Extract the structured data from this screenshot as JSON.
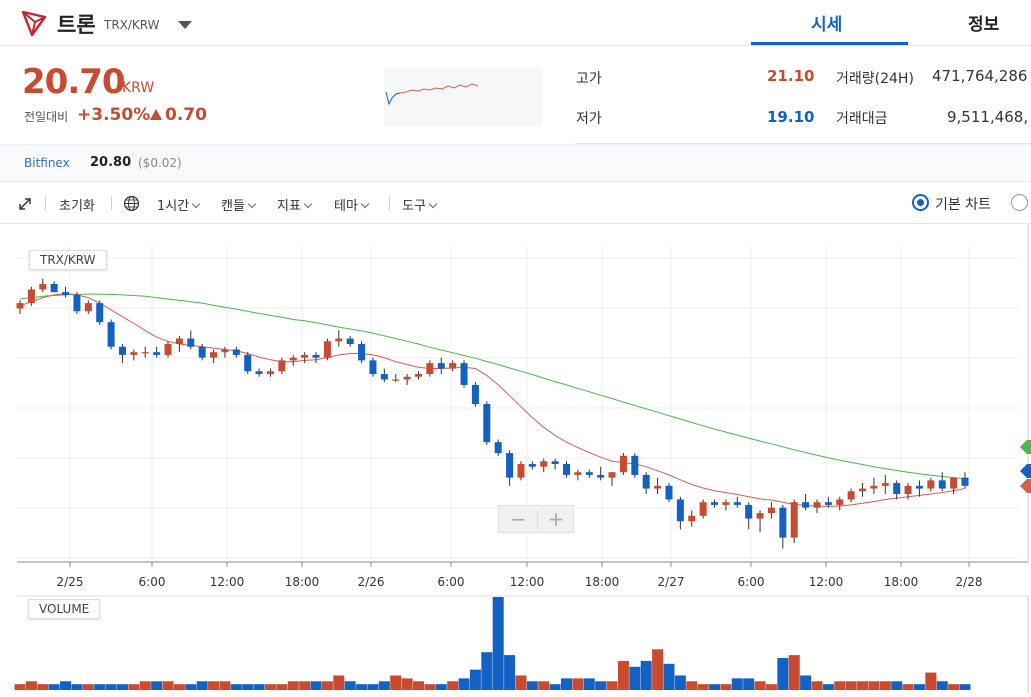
{
  "header": {
    "coin_name": "트론",
    "pair": "TRX/KRW",
    "tabs": [
      {
        "label": "시세"
      },
      {
        "label": "정보"
      }
    ]
  },
  "ticker": {
    "price": "20.70",
    "unit": "KRW",
    "change_label": "전일대비",
    "change_rate": "+3.50%",
    "change_amount": "0.70",
    "high_label": "고가",
    "high": "21.10",
    "low_label": "저가",
    "low": "19.10",
    "volume_label": "거래량(24H)",
    "volume": "471,764,286",
    "amount_label": "거래대금",
    "amount": "9,511,468,"
  },
  "exchange": {
    "name": "Bitfinex",
    "price": "20.80",
    "diff": "($0.02)"
  },
  "toolbar": {
    "reset": "초기화",
    "interval": "1시간",
    "candle": "캔들",
    "indicator": "지표",
    "theme": "테마",
    "tools": "도구",
    "basic_chart": "기본 차트"
  },
  "colors": {
    "up": "#c84a31",
    "down": "#1261c4",
    "accent": "#1261c4",
    "ma_short": "#d4604e",
    "ma_long": "#4ab84a"
  },
  "chart_data": {
    "type": "candlestick",
    "title": "TRX/KRW",
    "volume_title": "VOLUME",
    "x_tick_labels": [
      "2/25",
      "6:00",
      "12:00",
      "18:00",
      "2/26",
      "6:00",
      "12:00",
      "18:00",
      "2/27",
      "6:00",
      "12:00",
      "18:00",
      "2/28"
    ],
    "candles_ohlc": [
      [
        23.0,
        23.3,
        22.8,
        23.2
      ],
      [
        23.2,
        23.8,
        23.1,
        23.7
      ],
      [
        23.7,
        24.1,
        23.6,
        23.9
      ],
      [
        23.9,
        24.0,
        23.6,
        23.6
      ],
      [
        23.6,
        23.8,
        23.4,
        23.5
      ],
      [
        23.5,
        23.6,
        22.8,
        22.9
      ],
      [
        22.9,
        23.3,
        22.8,
        23.2
      ],
      [
        23.2,
        23.3,
        22.4,
        22.5
      ],
      [
        22.5,
        22.6,
        21.5,
        21.6
      ],
      [
        21.6,
        21.7,
        21.0,
        21.3
      ],
      [
        21.3,
        21.5,
        21.1,
        21.4
      ],
      [
        21.4,
        21.6,
        21.2,
        21.4
      ],
      [
        21.4,
        21.6,
        21.2,
        21.3
      ],
      [
        21.3,
        21.8,
        21.2,
        21.7
      ],
      [
        21.7,
        22.0,
        21.4,
        21.9
      ],
      [
        21.9,
        22.2,
        21.5,
        21.6
      ],
      [
        21.6,
        21.7,
        21.1,
        21.2
      ],
      [
        21.2,
        21.5,
        21.0,
        21.4
      ],
      [
        21.4,
        21.6,
        21.2,
        21.5
      ],
      [
        21.5,
        21.6,
        21.2,
        21.3
      ],
      [
        21.3,
        21.4,
        20.6,
        20.7
      ],
      [
        20.7,
        20.8,
        20.5,
        20.6
      ],
      [
        20.6,
        20.8,
        20.5,
        20.7
      ],
      [
        20.7,
        21.2,
        20.6,
        21.1
      ],
      [
        21.1,
        21.3,
        20.9,
        21.2
      ],
      [
        21.2,
        21.4,
        21.0,
        21.3
      ],
      [
        21.3,
        21.4,
        21.0,
        21.2
      ],
      [
        21.2,
        21.9,
        21.1,
        21.8
      ],
      [
        21.8,
        22.2,
        21.6,
        21.9
      ],
      [
        21.9,
        22.0,
        21.6,
        21.7
      ],
      [
        21.7,
        21.8,
        21.0,
        21.1
      ],
      [
        21.1,
        21.2,
        20.5,
        20.6
      ],
      [
        20.6,
        20.8,
        20.3,
        20.4
      ],
      [
        20.4,
        20.6,
        20.3,
        20.4
      ],
      [
        20.4,
        20.6,
        20.2,
        20.5
      ],
      [
        20.5,
        20.7,
        20.4,
        20.6
      ],
      [
        20.6,
        21.1,
        20.5,
        21.0
      ],
      [
        21.0,
        21.2,
        20.6,
        20.8
      ],
      [
        20.8,
        21.1,
        20.7,
        21.0
      ],
      [
        21.0,
        21.1,
        20.1,
        20.2
      ],
      [
        20.2,
        20.3,
        19.4,
        19.5
      ],
      [
        19.5,
        19.6,
        18.0,
        18.1
      ],
      [
        18.1,
        18.2,
        17.6,
        17.7
      ],
      [
        17.7,
        17.8,
        16.5,
        16.8
      ],
      [
        16.8,
        17.4,
        16.7,
        17.3
      ],
      [
        17.3,
        17.4,
        17.1,
        17.2
      ],
      [
        17.2,
        17.5,
        17.0,
        17.4
      ],
      [
        17.4,
        17.5,
        17.1,
        17.3
      ],
      [
        17.3,
        17.4,
        16.8,
        16.9
      ],
      [
        16.9,
        17.1,
        16.7,
        17.0
      ],
      [
        17.0,
        17.1,
        16.8,
        16.9
      ],
      [
        16.9,
        17.2,
        16.7,
        16.8
      ],
      [
        16.8,
        17.0,
        16.5,
        17.0
      ],
      [
        17.0,
        17.7,
        16.9,
        17.6
      ],
      [
        17.6,
        17.7,
        16.8,
        16.9
      ],
      [
        16.9,
        17.0,
        16.2,
        16.4
      ],
      [
        16.4,
        16.8,
        16.2,
        16.5
      ],
      [
        16.5,
        16.6,
        15.9,
        16.0
      ],
      [
        16.0,
        16.1,
        14.9,
        15.2
      ],
      [
        15.2,
        15.6,
        15.0,
        15.4
      ],
      [
        15.4,
        16.0,
        15.3,
        15.9
      ],
      [
        15.9,
        16.0,
        15.7,
        15.8
      ],
      [
        15.8,
        16.0,
        15.6,
        15.9
      ],
      [
        15.9,
        16.1,
        15.7,
        15.8
      ],
      [
        15.8,
        15.9,
        14.9,
        15.3
      ],
      [
        15.3,
        15.6,
        14.8,
        15.5
      ],
      [
        15.5,
        15.9,
        15.3,
        15.7
      ],
      [
        15.7,
        15.8,
        14.2,
        14.6
      ],
      [
        14.6,
        16.0,
        14.4,
        15.9
      ],
      [
        15.9,
        16.2,
        15.6,
        15.7
      ],
      [
        15.7,
        16.0,
        15.5,
        15.9
      ],
      [
        15.9,
        16.1,
        15.7,
        15.8
      ],
      [
        15.8,
        16.1,
        15.6,
        16.0
      ],
      [
        16.0,
        16.4,
        15.9,
        16.3
      ],
      [
        16.3,
        16.6,
        16.1,
        16.4
      ],
      [
        16.4,
        16.8,
        16.2,
        16.5
      ],
      [
        16.5,
        16.9,
        16.2,
        16.6
      ],
      [
        16.6,
        16.7,
        16.0,
        16.2
      ],
      [
        16.2,
        16.6,
        16.0,
        16.5
      ],
      [
        16.5,
        16.7,
        16.1,
        16.4
      ],
      [
        16.4,
        16.8,
        16.3,
        16.7
      ],
      [
        16.7,
        17.0,
        16.3,
        16.4
      ],
      [
        16.4,
        16.8,
        16.2,
        16.8
      ],
      [
        16.8,
        17.0,
        16.4,
        16.5
      ]
    ],
    "ma_short": [
      23.1,
      23.25,
      23.4,
      23.5,
      23.55,
      23.5,
      23.4,
      23.2,
      22.95,
      22.7,
      22.45,
      22.2,
      21.95,
      21.8,
      21.7,
      21.65,
      21.6,
      21.55,
      21.5,
      21.45,
      21.35,
      21.22,
      21.12,
      21.05,
      21.05,
      21.1,
      21.12,
      21.2,
      21.3,
      21.35,
      21.35,
      21.3,
      21.2,
      21.05,
      20.95,
      20.85,
      20.8,
      20.8,
      20.82,
      20.85,
      20.8,
      20.55,
      20.2,
      19.8,
      19.4,
      19.0,
      18.65,
      18.35,
      18.1,
      17.9,
      17.72,
      17.55,
      17.4,
      17.35,
      17.3,
      17.2,
      17.05,
      16.9,
      16.72,
      16.55,
      16.42,
      16.32,
      16.25,
      16.18,
      16.1,
      16.02,
      15.98,
      15.9,
      15.82,
      15.78,
      15.75,
      15.75,
      15.76,
      15.8,
      15.86,
      15.92,
      16.0,
      16.05,
      16.1,
      16.15,
      16.2,
      16.25,
      16.32,
      16.4
    ],
    "ma_long": [
      23.35,
      23.4,
      23.45,
      23.48,
      23.5,
      23.52,
      23.53,
      23.53,
      23.52,
      23.5,
      23.48,
      23.45,
      23.4,
      23.35,
      23.3,
      23.25,
      23.2,
      23.12,
      23.05,
      22.98,
      22.9,
      22.82,
      22.75,
      22.68,
      22.6,
      22.55,
      22.48,
      22.4,
      22.32,
      22.25,
      22.18,
      22.1,
      22.0,
      21.9,
      21.8,
      21.7,
      21.58,
      21.48,
      21.38,
      21.28,
      21.18,
      21.06,
      20.95,
      20.82,
      20.7,
      20.58,
      20.45,
      20.32,
      20.2,
      20.07,
      19.95,
      19.82,
      19.7,
      19.57,
      19.45,
      19.32,
      19.2,
      19.07,
      18.95,
      18.82,
      18.7,
      18.58,
      18.47,
      18.36,
      18.25,
      18.14,
      18.04,
      17.93,
      17.82,
      17.72,
      17.62,
      17.53,
      17.44,
      17.36,
      17.28,
      17.2,
      17.13,
      17.06,
      17.0,
      16.94,
      16.89,
      16.84,
      16.8,
      16.76
    ],
    "volume": [
      2,
      3,
      2,
      2,
      3,
      2,
      2,
      2,
      2,
      2,
      2,
      3,
      3,
      3,
      2,
      2,
      3,
      3,
      3,
      2,
      2,
      2,
      2,
      2,
      3,
      3,
      3,
      3,
      5,
      3,
      2,
      2,
      3,
      5,
      4,
      3,
      2,
      2,
      3,
      4,
      7,
      13,
      32,
      12,
      5,
      3,
      3,
      2,
      4,
      4,
      4,
      3,
      3,
      10,
      8,
      10,
      14,
      9,
      5,
      3,
      2,
      2,
      2,
      4,
      4,
      3,
      2,
      11,
      12,
      5,
      3,
      2,
      3,
      3,
      3,
      3,
      3,
      3,
      2,
      2,
      6,
      3,
      2,
      2
    ],
    "ylim": [
      14.0,
      25.0
    ]
  }
}
